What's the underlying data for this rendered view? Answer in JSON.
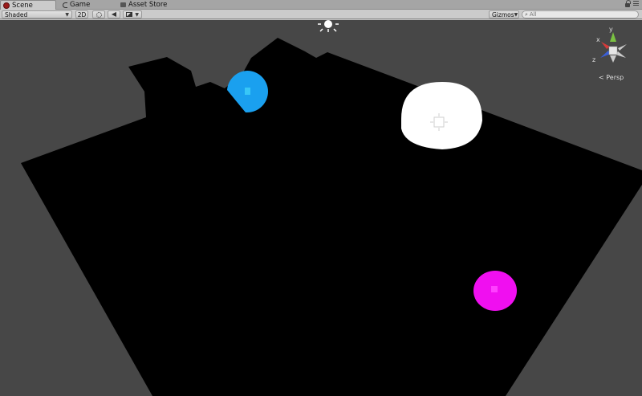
{
  "tabs": [
    {
      "label": "Scene",
      "active": true,
      "icon": "scene-icon"
    },
    {
      "label": "Game",
      "active": false,
      "icon": "game-icon"
    },
    {
      "label": "Asset Store",
      "active": false,
      "icon": "asset-store-icon"
    }
  ],
  "toolbar": {
    "shading_mode": "Shaded",
    "mode_2d_label": "2D",
    "gizmos_label": "Gizmos",
    "search_placeholder": "All"
  },
  "gizmo": {
    "projection_label": "Persp",
    "axes": [
      "x",
      "y",
      "z"
    ],
    "colors": {
      "x": "#d63b3b",
      "y": "#7ac142",
      "z": "#3a5fd8"
    }
  },
  "scene": {
    "background_color": "#474747",
    "ground_color": "#000000",
    "objects": [
      {
        "name": "blue-sphere",
        "color": "#1aa0ef"
      },
      {
        "name": "white-sphere",
        "color": "#ffffff"
      },
      {
        "name": "magenta-sphere",
        "color": "#f00ff0"
      }
    ]
  }
}
